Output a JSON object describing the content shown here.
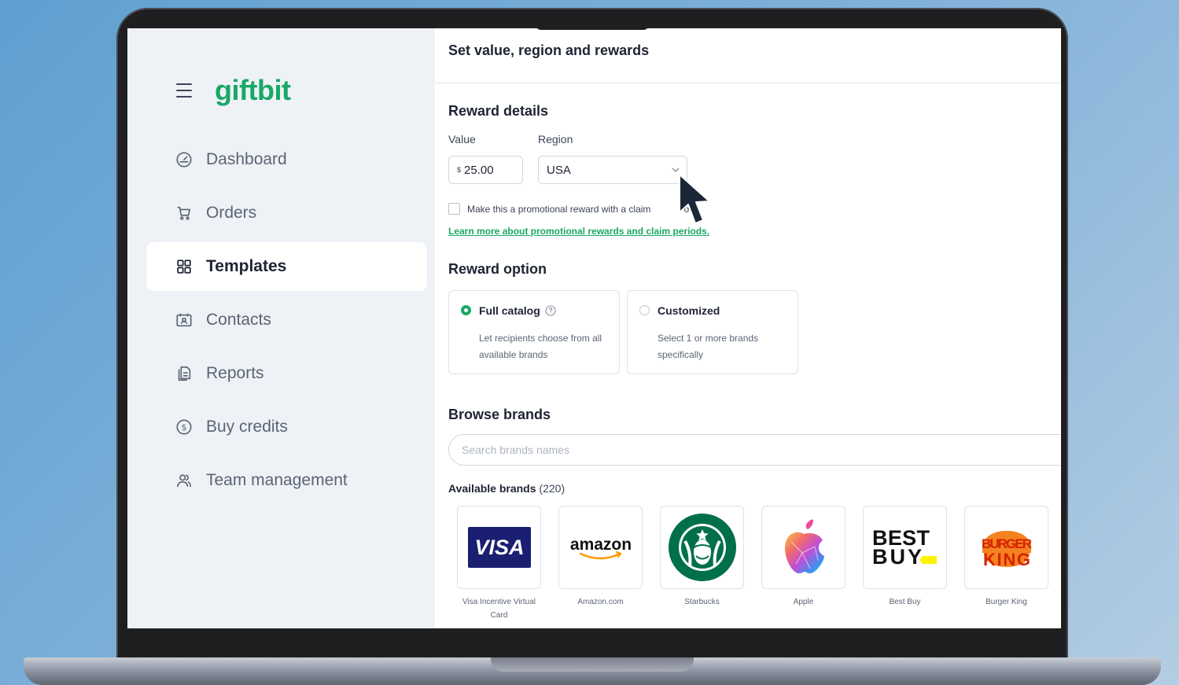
{
  "app": {
    "logo": "giftbit"
  },
  "sidebar": {
    "items": [
      {
        "label": "Dashboard",
        "icon": "gauge-icon",
        "active": false
      },
      {
        "label": "Orders",
        "icon": "cart-icon",
        "active": false
      },
      {
        "label": "Templates",
        "icon": "grid-icon",
        "active": true
      },
      {
        "label": "Contacts",
        "icon": "contact-card-icon",
        "active": false
      },
      {
        "label": "Reports",
        "icon": "document-icon",
        "active": false
      },
      {
        "label": "Buy credits",
        "icon": "dollar-circle-icon",
        "active": false
      },
      {
        "label": "Team management",
        "icon": "team-icon",
        "active": false
      }
    ]
  },
  "main": {
    "page_title": "Set value, region and rewards",
    "reward_details": {
      "title": "Reward details",
      "value_label": "Value",
      "currency_symbol": "$",
      "value": "25.00",
      "region_label": "Region",
      "region": "USA",
      "promo_checkbox_label": "Make this a promotional reward with a claim",
      "promo_checkbox_tail": "od",
      "learn_more_link": "Learn more about promotional rewards and claim periods."
    },
    "reward_option": {
      "title": "Reward option",
      "options": [
        {
          "title": "Full catalog",
          "desc": "Let recipients choose from all available brands",
          "selected": true
        },
        {
          "title": "Customized",
          "desc": "Select 1 or more brands specifically",
          "selected": false
        }
      ]
    },
    "browse_brands": {
      "title": "Browse brands",
      "search_placeholder": "Search brands names",
      "available_label": "Available brands",
      "available_count": "(220)",
      "brands": [
        {
          "name": "Visa Incentive Virtual Card",
          "logo_text": "VISA"
        },
        {
          "name": "Amazon.com",
          "logo_text": "amazon"
        },
        {
          "name": "Starbucks",
          "logo_text": ""
        },
        {
          "name": "Apple",
          "logo_text": ""
        },
        {
          "name": "Best Buy",
          "logo_text": "BEST BUY"
        },
        {
          "name": "Burger King",
          "logo_text": "BURGER KING"
        }
      ]
    }
  },
  "colors": {
    "brand_green": "#19a866",
    "sidebar_bg": "#eef2f7",
    "text_dark": "#1e2433"
  }
}
